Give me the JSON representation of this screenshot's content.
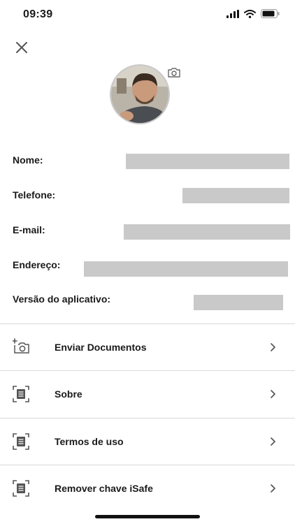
{
  "status_bar": {
    "time": "09:39",
    "icons": [
      "signal-icon",
      "wifi-icon",
      "battery-icon"
    ]
  },
  "header": {
    "close_icon": "close-icon"
  },
  "profile": {
    "camera_icon": "camera-icon"
  },
  "info": {
    "fields": [
      {
        "label": "Nome:"
      },
      {
        "label": "Telefone:"
      },
      {
        "label": "E-mail:"
      },
      {
        "label": "Endereço:"
      },
      {
        "label": "Versão do aplicativo:"
      }
    ]
  },
  "menu": {
    "items": [
      {
        "label": "Enviar Documentos",
        "icon": "add-photo-icon"
      },
      {
        "label": "Sobre",
        "icon": "document-scan-icon"
      },
      {
        "label": "Termos de uso",
        "icon": "document-scan-icon"
      },
      {
        "label": "Remover chave iSafe",
        "icon": "document-scan-icon"
      }
    ]
  },
  "colors": {
    "redaction": "#c9c9c9",
    "text": "#1a1a1a",
    "divider": "#d9d9d9",
    "icon": "#555555"
  }
}
